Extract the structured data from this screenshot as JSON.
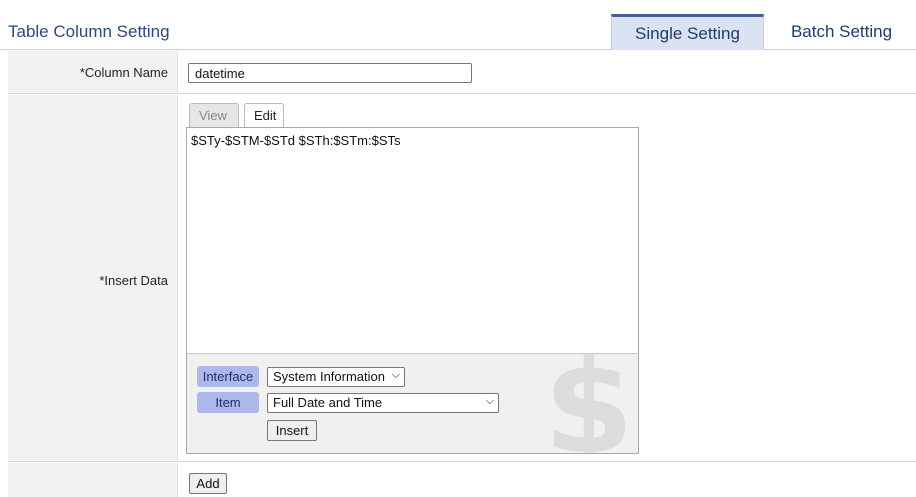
{
  "header": {
    "title": "Table Column Setting",
    "tabs": {
      "single": "Single Setting",
      "batch": "Batch Setting"
    }
  },
  "form": {
    "column_name": {
      "label": "*Column Name",
      "value": "datetime"
    },
    "insert_data": {
      "label": "*Insert Data",
      "tabs": {
        "view": "View",
        "edit": "Edit"
      },
      "content": "$STy-$STM-$STd $STh:$STm:$STs",
      "watermark": "$",
      "interface": {
        "label": "Interface",
        "selected": "System Information"
      },
      "item": {
        "label": "Item",
        "selected": "Full Date and Time"
      },
      "insert_button": "Insert"
    },
    "add_button": "Add"
  },
  "icons": {
    "dropdown": "chevron-down-icon"
  },
  "colors": {
    "accent": "#3f5f95",
    "tab_active_bg": "#dbe2f1",
    "pill_bg": "#aeb8ea",
    "label_bg": "#f2f2f2"
  }
}
